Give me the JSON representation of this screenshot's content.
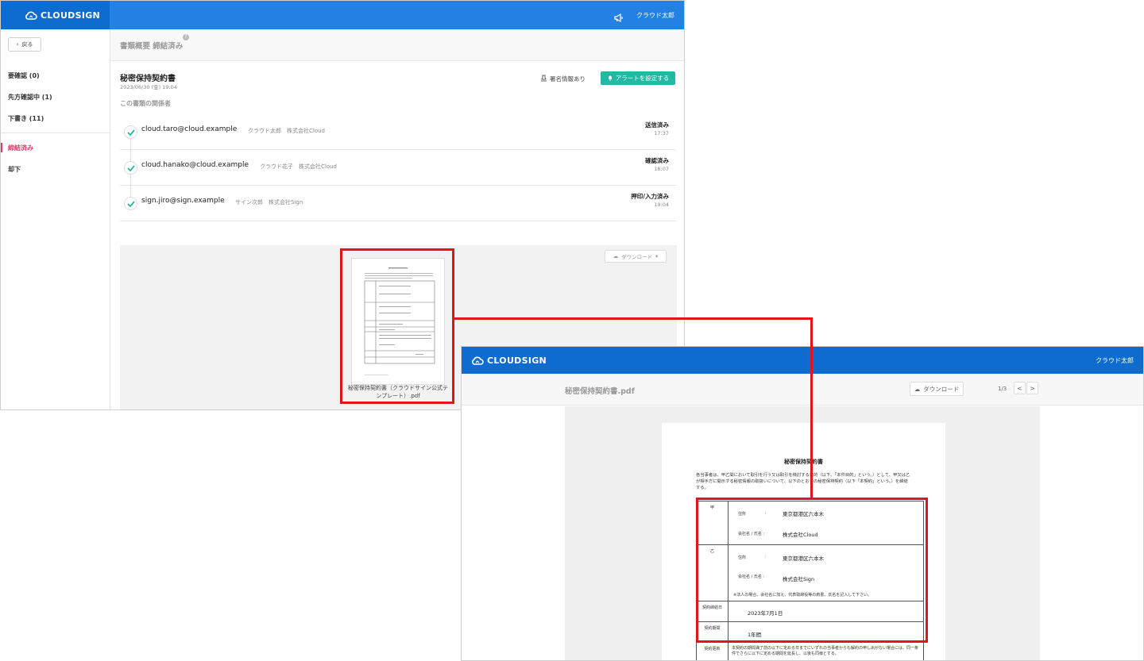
{
  "brand": {
    "name": "CLOUDSIGN",
    "accent": "#2480e2",
    "brand_dark": "#0e6bcf",
    "teal": "#22b8a2",
    "highlight_red": "#e0161b",
    "active_pink": "#e5386a"
  },
  "overview": {
    "header": {
      "user": "クラウド太郎",
      "notice_icon": "megaphone-icon"
    },
    "back_label": "戻る",
    "page_title": "書類概要 締結済み",
    "help_icon": "?",
    "sidebar": {
      "items": [
        {
          "label": "要確認 (0)"
        },
        {
          "label": "先方確認中 (1)"
        },
        {
          "label": "下書き (11)"
        },
        {
          "label": "締結済み"
        },
        {
          "label": "却下"
        }
      ]
    },
    "document": {
      "title": "秘密保持契約書",
      "date": "2023/06/30 (金) 19:04",
      "signature_info": "署名情報あり",
      "alert_button": "アラートを設定する",
      "parties_label": "この書類の関係者"
    },
    "parties": [
      {
        "email": "cloud.taro@cloud.example",
        "name": "クラウド太郎　株式会社Cloud",
        "status": "送信済み",
        "time": "17:37"
      },
      {
        "email": "cloud.hanako@cloud.example",
        "name": "クラウド花子　株式会社Cloud",
        "status": "確認済み",
        "time": "18:07"
      },
      {
        "email": "sign.jiro@sign.example",
        "name": "サイン次郎　株式会社Sign",
        "status": "押印/入力済み",
        "time": "19:04"
      }
    ],
    "preview": {
      "download_label": "ダウンロード",
      "file_caption": "秘密保持契約書（クラウドサイン公式テンプレート）.pdf"
    }
  },
  "viewer": {
    "header": {
      "user": "クラウド太郎"
    },
    "file_title": "秘密保持契約書.pdf",
    "download_label": "ダウンロード",
    "page_indicator": "1/3",
    "prev": "<",
    "next": ">",
    "paper": {
      "title": "秘密保持契約書",
      "intro": "各当事者は、甲乙間において取引を行う又は取引を検討する目的（以下、「本件目的」という。）として、甲又は乙が相手方に開示する秘密情報の取扱いについて、以下のとおりの秘密保持契約（以下「本契約」という。）を締結する。",
      "party_a": {
        "label": "甲",
        "address_label": "住所",
        "colon": ":",
        "address": "東京都港区六本木",
        "company_label": "会社名 / 氏名 :",
        "company": "株式会社Cloud"
      },
      "party_b": {
        "label": "乙",
        "address_label": "住所",
        "colon": ":",
        "address": "東京都港区六本木",
        "company_label": "会社名 / 氏名 :",
        "company": "株式会社Sign",
        "note": "※法人の場合、会社名に加え、代表取締役等の肩書、氏名を記入して下さい。"
      },
      "date_label": "契約締結日",
      "date_value": "2023年7月1日",
      "term_label": "契約期間",
      "term_value": "1年間",
      "renew_label": "契約更新",
      "renew_value": "本契約の期間満了前の以下に定める日までにいずれの当事者からも解約の申し出がない場合には、同一条件でさらに以下に定める期間を延長し、以後も同様とする。"
    }
  }
}
